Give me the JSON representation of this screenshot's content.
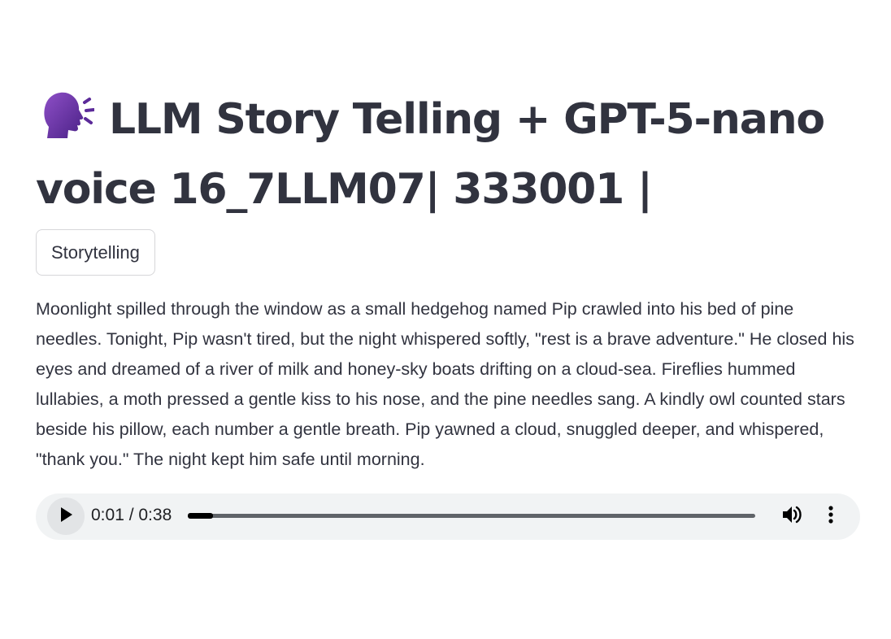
{
  "header": {
    "icon": "speaking-head-icon",
    "title_line1": "LLM Story Telling + GPT-5-nano",
    "title_line2": "voice 16_7LLM07| 333001 |"
  },
  "tag_button": {
    "label": "Storytelling"
  },
  "story": {
    "text": "Moonlight spilled through the window as a small hedgehog named Pip crawled into his bed of pine needles. Tonight, Pip wasn't tired, but the night whispered softly, \"rest is a brave adventure.\" He closed his eyes and dreamed of a river of milk and honey-sky boats drifting on a cloud-sea. Fireflies hummed lullabies, a moth pressed a gentle kiss to his nose, and the pine needles sang. A kindly owl counted stars beside his pillow, each number a gentle breath. Pip yawned a cloud, snuggled deeper, and whispered, \"thank you.\" The night kept him safe until morning."
  },
  "audio_player": {
    "time_display": "0:01 / 0:38",
    "progress_fraction": 0.045,
    "icons": {
      "play": "play-icon",
      "volume": "volume-icon",
      "more": "more-vertical-icon"
    },
    "colors": {
      "background": "#f1f3f4",
      "track": "#5f6368",
      "fill": "#000000"
    }
  }
}
